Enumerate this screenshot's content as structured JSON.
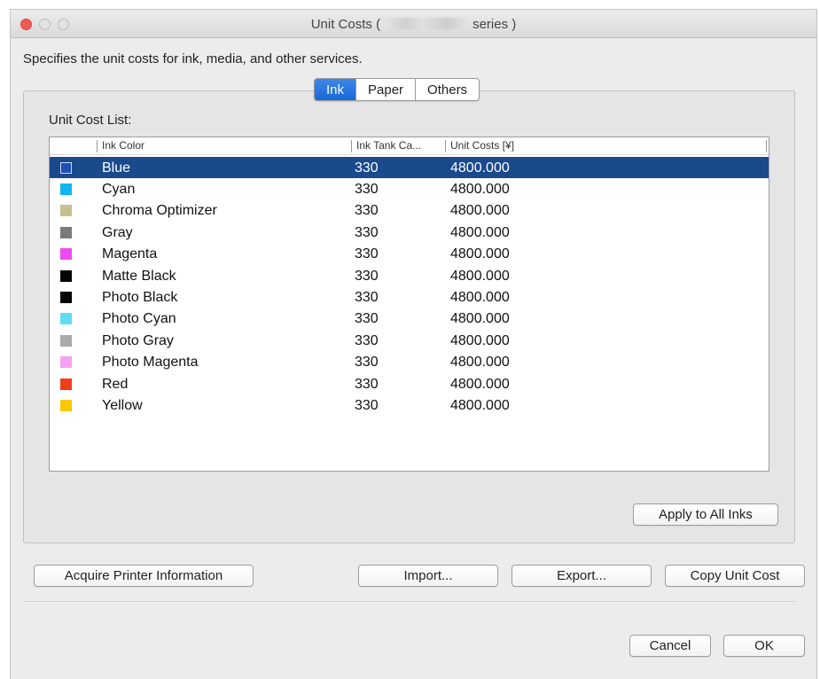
{
  "window": {
    "title_prefix": "Unit Costs (",
    "title_suffix": "series )"
  },
  "description": "Specifies the unit costs for ink, media, and other services.",
  "tabs": [
    {
      "label": "Ink",
      "active": true
    },
    {
      "label": "Paper",
      "active": false
    },
    {
      "label": "Others",
      "active": false
    }
  ],
  "list_label": "Unit Cost List:",
  "columns": {
    "ink_color": "Ink Color",
    "tank_capacity": "Ink Tank Ca...",
    "unit_costs": "Unit Costs [¥]"
  },
  "rows": [
    {
      "name": "Blue",
      "capacity": "330",
      "cost": "4800.000",
      "color": "#1f4fb4",
      "selected": true
    },
    {
      "name": "Cyan",
      "capacity": "330",
      "cost": "4800.000",
      "color": "#12b5ee",
      "selected": false
    },
    {
      "name": "Chroma Optimizer",
      "capacity": "330",
      "cost": "4800.000",
      "color": "#c5c08f",
      "selected": false
    },
    {
      "name": "Gray",
      "capacity": "330",
      "cost": "4800.000",
      "color": "#7a7a7a",
      "selected": false
    },
    {
      "name": "Magenta",
      "capacity": "330",
      "cost": "4800.000",
      "color": "#ee48ef",
      "selected": false
    },
    {
      "name": "Matte Black",
      "capacity": "330",
      "cost": "4800.000",
      "color": "#050505",
      "selected": false
    },
    {
      "name": "Photo Black",
      "capacity": "330",
      "cost": "4800.000",
      "color": "#050505",
      "selected": false
    },
    {
      "name": "Photo Cyan",
      "capacity": "330",
      "cost": "4800.000",
      "color": "#60dcf4",
      "selected": false
    },
    {
      "name": "Photo Gray",
      "capacity": "330",
      "cost": "4800.000",
      "color": "#aaaaaa",
      "selected": false
    },
    {
      "name": "Photo Magenta",
      "capacity": "330",
      "cost": "4800.000",
      "color": "#f5a0f2",
      "selected": false
    },
    {
      "name": "Red",
      "capacity": "330",
      "cost": "4800.000",
      "color": "#f03e18",
      "selected": false
    },
    {
      "name": "Yellow",
      "capacity": "330",
      "cost": "4800.000",
      "color": "#f8c800",
      "selected": false
    }
  ],
  "buttons": {
    "apply_all": "Apply to All Inks",
    "acquire": "Acquire Printer Information",
    "import": "Import...",
    "export": "Export...",
    "copy": "Copy Unit Cost",
    "cancel": "Cancel",
    "ok": "OK"
  },
  "icons": {
    "close": "close-icon",
    "minimize": "minimize-icon",
    "zoom": "zoom-icon"
  }
}
